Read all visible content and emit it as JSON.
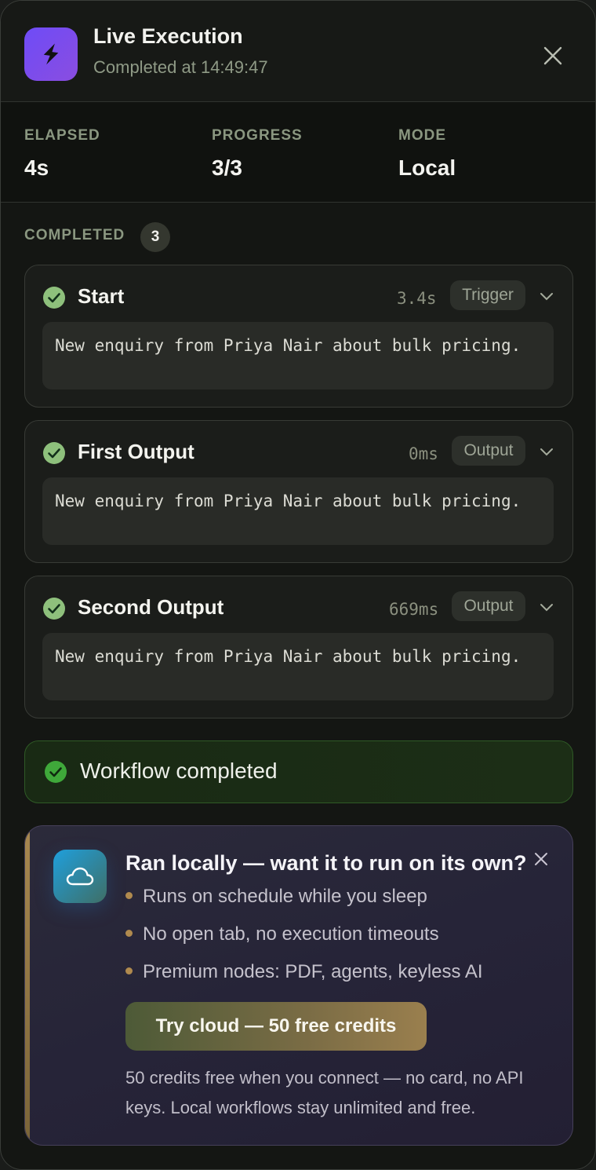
{
  "header": {
    "title": "Live Execution",
    "subtitle": "Completed at 14:49:47",
    "icon": "lightning-bolt-icon",
    "accent": "#7c4dff"
  },
  "stats": [
    {
      "label": "ELAPSED",
      "value": "4s"
    },
    {
      "label": "PROGRESS",
      "value": "3/3"
    },
    {
      "label": "MODE",
      "value": "Local"
    }
  ],
  "completed": {
    "label": "COMPLETED",
    "count": "3",
    "steps": [
      {
        "name": "Start",
        "duration": "3.4s",
        "tag": "Trigger",
        "output": "New enquiry from Priya Nair about bulk pricing."
      },
      {
        "name": "First Output",
        "duration": "0ms",
        "tag": "Output",
        "output": "New enquiry from Priya Nair about bulk pricing."
      },
      {
        "name": "Second Output",
        "duration": "669ms",
        "tag": "Output",
        "output": "New enquiry from Priya Nair about bulk pricing."
      }
    ]
  },
  "status": {
    "text": "Workflow completed",
    "color": "#4caf50"
  },
  "promo": {
    "title": "Ran locally — want it to run on its own?",
    "bullets": [
      "Runs on schedule while you sleep",
      "No open tab, no execution timeouts",
      "Premium nodes: PDF, agents, keyless AI"
    ],
    "cta_label": "Try cloud — 50 free credits",
    "note": "50 credits free when you connect — no card, no API keys. Local workflows stay unlimited and free.",
    "icon": "cloud-icon"
  }
}
